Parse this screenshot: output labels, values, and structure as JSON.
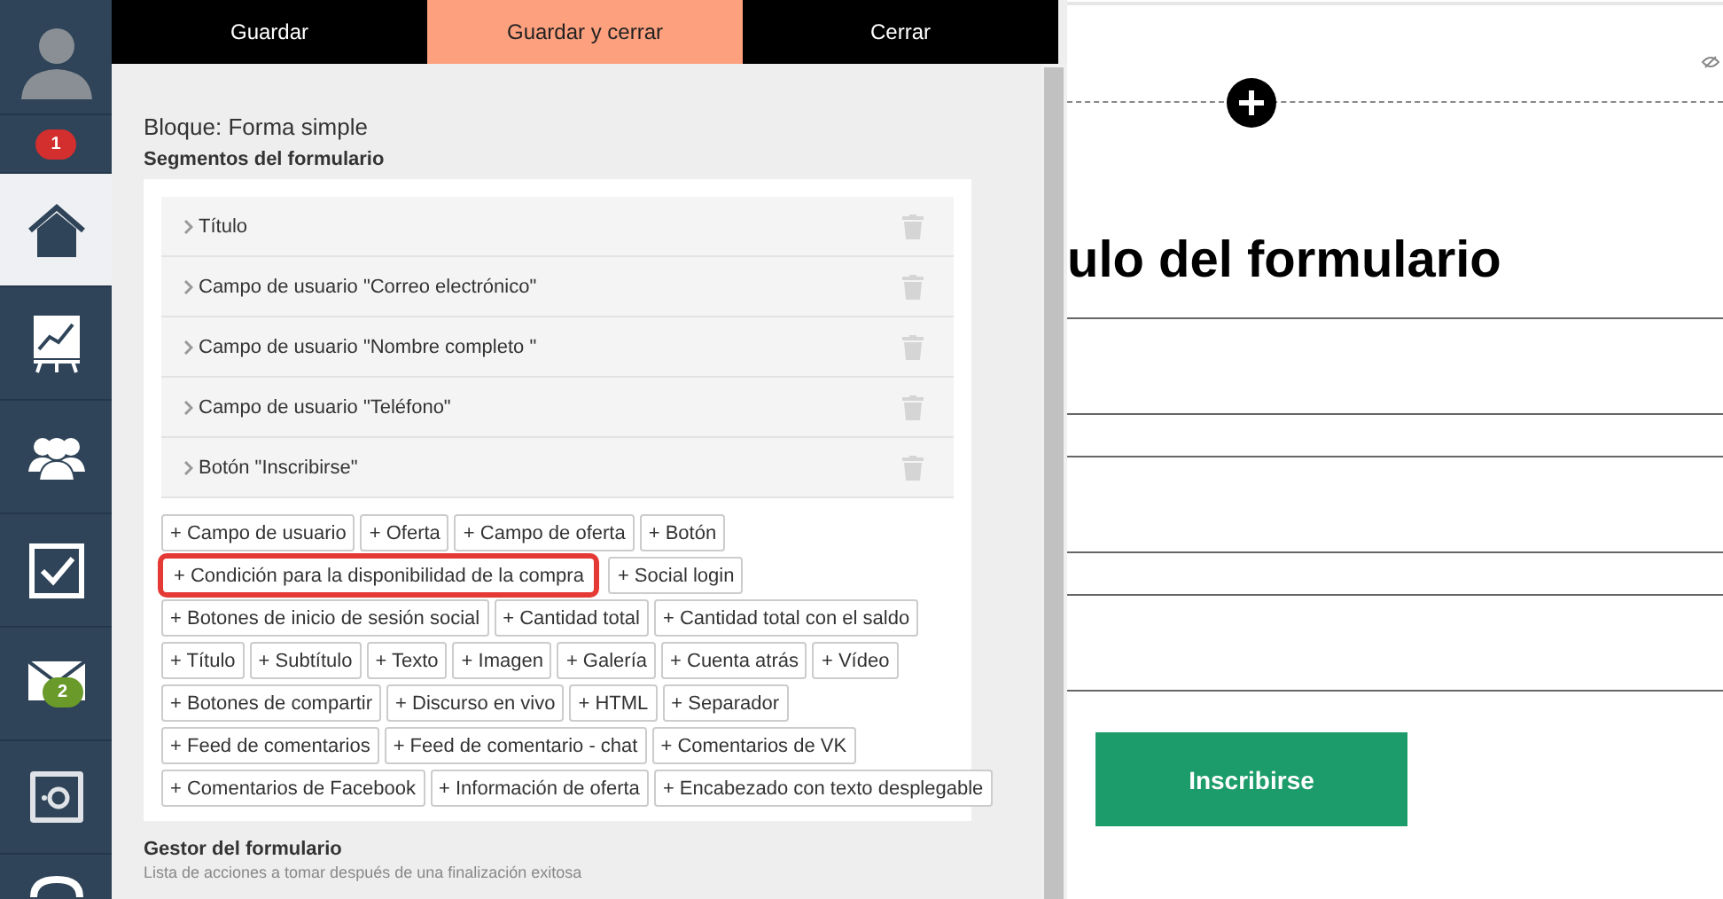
{
  "sidebar": {
    "badge": "1",
    "items": [
      {
        "kind": "home",
        "selected": true
      },
      {
        "kind": "chart",
        "selected": false
      },
      {
        "kind": "people",
        "selected": false
      },
      {
        "kind": "check",
        "selected": false
      },
      {
        "kind": "mail",
        "selected": false,
        "badge": "2"
      },
      {
        "kind": "safe",
        "selected": false
      },
      {
        "kind": "partial",
        "selected": false
      }
    ]
  },
  "toolbar": [
    {
      "label": "Guardar",
      "primary": false
    },
    {
      "label": "Guardar y cerrar",
      "primary": true
    },
    {
      "label": "Cerrar",
      "primary": false
    }
  ],
  "block_title": "Bloque: Forma simple",
  "segments_heading": "Segmentos del formulario",
  "segments": [
    "Título",
    "Campo de usuario \"Correo electrónico\"",
    "Campo de usuario \"Nombre completo \"",
    "Campo de usuario \"Teléfono\"",
    "Botón \"Inscribirse\""
  ],
  "add_rows": [
    [
      {
        "label": "+ Campo de usuario",
        "highlighted": false
      },
      {
        "label": "+ Oferta",
        "highlighted": false
      },
      {
        "label": "+ Campo de oferta",
        "highlighted": false
      },
      {
        "label": "+ Botón",
        "highlighted": false
      }
    ],
    [
      {
        "label": "+ Condición para la disponibilidad de la compra",
        "highlighted": true
      },
      {
        "label": "+ Social login",
        "highlighted": false
      }
    ],
    [
      {
        "label": "+ Botones de inicio de sesión social",
        "highlighted": false
      },
      {
        "label": "+ Cantidad total",
        "highlighted": false
      },
      {
        "label": "+ Cantidad total con el saldo",
        "highlighted": false
      }
    ],
    [
      {
        "label": "+ Título",
        "highlighted": false
      },
      {
        "label": "+ Subtítulo",
        "highlighted": false
      },
      {
        "label": "+ Texto",
        "highlighted": false
      },
      {
        "label": "+ Imagen",
        "highlighted": false
      },
      {
        "label": "+ Galería",
        "highlighted": false
      },
      {
        "label": "+ Cuenta atrás",
        "highlighted": false
      },
      {
        "label": "+ Vídeo",
        "highlighted": false
      }
    ],
    [
      {
        "label": "+ Botones de compartir",
        "highlighted": false
      },
      {
        "label": "+ Discurso en vivo",
        "highlighted": false
      },
      {
        "label": "+ HTML",
        "highlighted": false
      },
      {
        "label": "+ Separador",
        "highlighted": false
      }
    ],
    [
      {
        "label": "+ Feed de comentarios",
        "highlighted": false
      },
      {
        "label": "+ Feed de comentario - chat",
        "highlighted": false
      },
      {
        "label": "+ Comentarios de VK",
        "highlighted": false
      }
    ],
    [
      {
        "label": "+ Comentarios de Facebook",
        "highlighted": false
      },
      {
        "label": "+ Información de oferta",
        "highlighted": false
      },
      {
        "label": "+ Encabezado con texto desplegable",
        "highlighted": false
      }
    ]
  ],
  "manager": {
    "heading": "Gestor del formulario",
    "description": "Lista de acciones a tomar después de una finalización exitosa"
  },
  "preview": {
    "title": "ulo del formulario",
    "button": "Inscribirse"
  }
}
